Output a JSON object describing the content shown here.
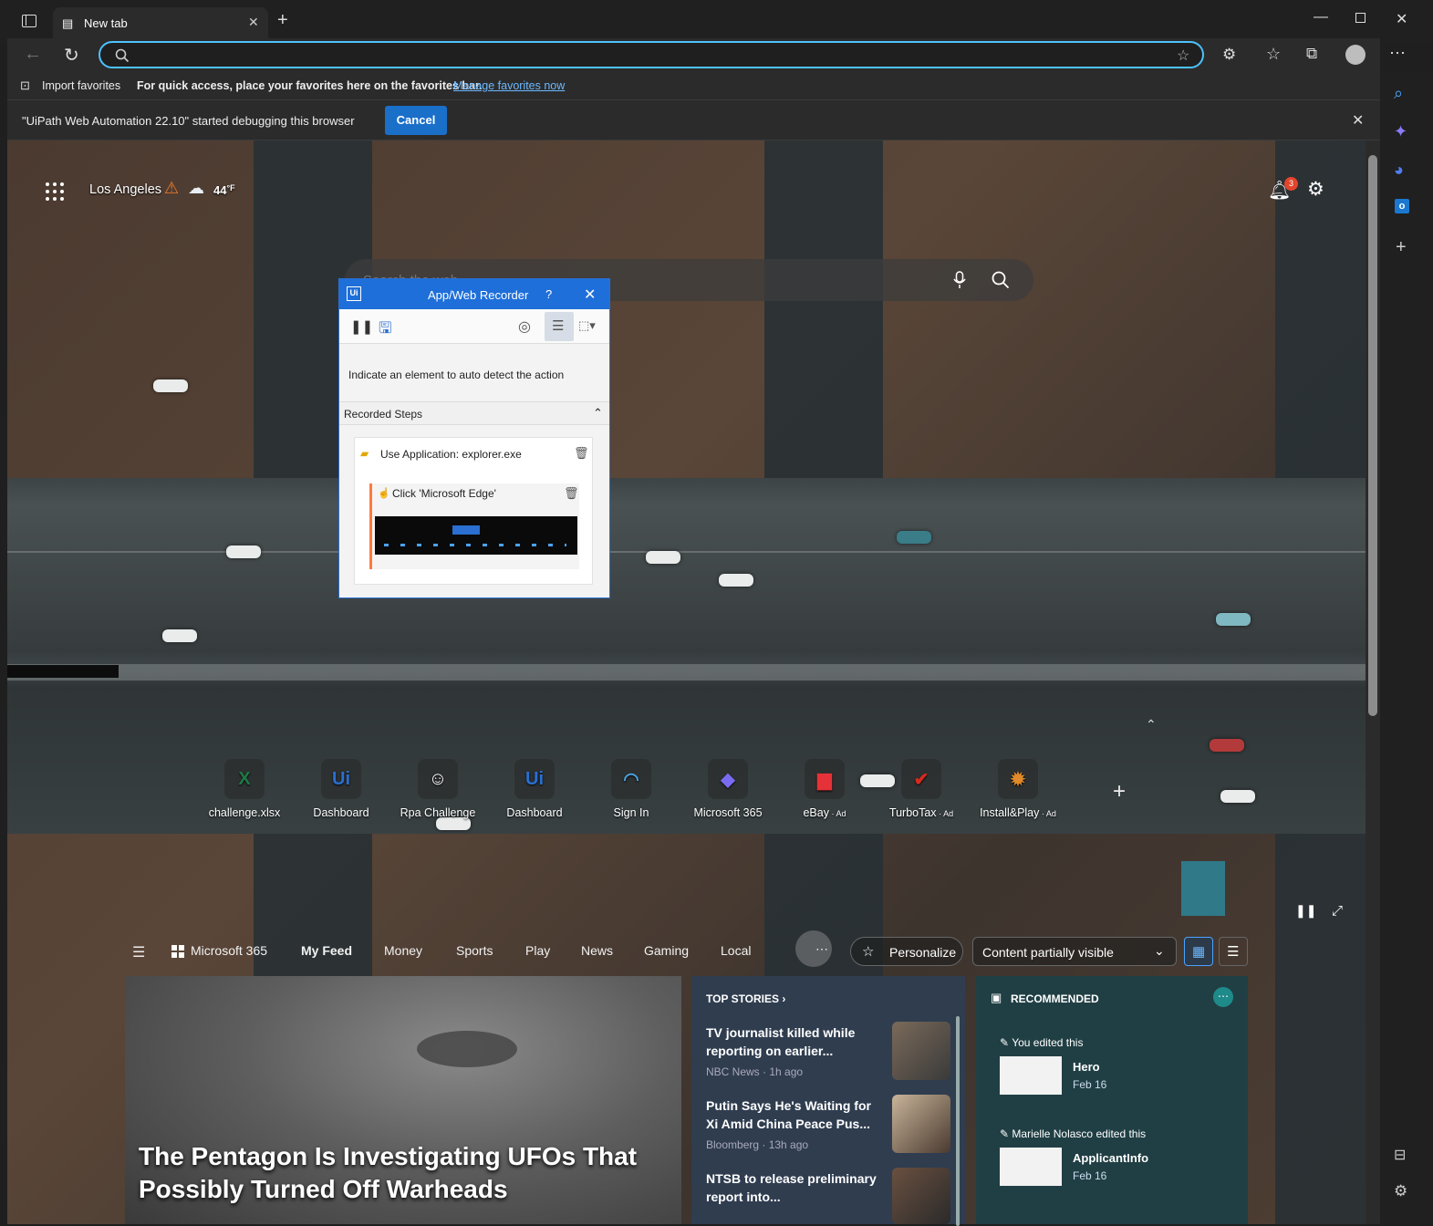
{
  "browser": {
    "tab_title": "New tab",
    "address_value": "",
    "favorites_bar": {
      "import_label": "Import favorites",
      "message": "For quick access, place your favorites here on the favorites bar.",
      "manage_link": "Manage favorites now"
    },
    "infobar": {
      "message": "\"UiPath Web Automation 22.10\" started debugging this browser",
      "cancel_label": "Cancel"
    }
  },
  "newtab": {
    "location": "Los Angeles",
    "temperature": "44",
    "temp_unit": "°F",
    "notification_count": "3",
    "search_placeholder": "Search the web",
    "quick_links": [
      {
        "label": "challenge.xlsx",
        "ad": "",
        "icon": "excel-icon",
        "glyph": "X",
        "color": "#1d7a46"
      },
      {
        "label": "Dashboard",
        "ad": "",
        "icon": "uipath-icon",
        "glyph": "Ui",
        "color": "#2a6fd1"
      },
      {
        "label": "Rpa Challenge",
        "ad": "",
        "icon": "robot-icon",
        "glyph": "☺",
        "color": "#ffffff"
      },
      {
        "label": "Dashboard",
        "ad": "",
        "icon": "uipath-icon",
        "glyph": "Ui",
        "color": "#2a6fd1"
      },
      {
        "label": "Sign In",
        "ad": "",
        "icon": "signin-icon",
        "glyph": "◠",
        "color": "#4aa3df"
      },
      {
        "label": "Microsoft 365",
        "ad": "",
        "icon": "m365-icon",
        "glyph": "◆",
        "color": "#7a6cf0"
      },
      {
        "label": "eBay",
        "ad": "· Ad",
        "icon": "ebay-icon",
        "glyph": "▆",
        "color": "#e53238"
      },
      {
        "label": "TurboTax",
        "ad": "· Ad",
        "icon": "turbotax-icon",
        "glyph": "✔",
        "color": "#d52b1e"
      },
      {
        "label": "Install&Play",
        "ad": "· Ad",
        "icon": "game-icon",
        "glyph": "✹",
        "color": "#e08a2a"
      }
    ],
    "nav": {
      "m365": "Microsoft 365",
      "tabs": [
        "My Feed",
        "Money",
        "Sports",
        "Play",
        "News",
        "Gaming",
        "Local"
      ],
      "personalize": "Personalize",
      "content_visibility": "Content partially visible"
    },
    "hero_title": "The Pentagon Is Investigating UFOs That Possibly Turned Off Warheads",
    "top_stories": {
      "header": "TOP STORIES",
      "items": [
        {
          "title": "TV journalist killed while reporting on earlier...",
          "meta": "NBC News · 1h ago"
        },
        {
          "title": "Putin Says He's Waiting for Xi Amid China Peace Pus...",
          "meta": "Bloomberg · 13h ago"
        },
        {
          "title": "NTSB to release preliminary report into...",
          "meta": ""
        }
      ]
    },
    "recommended": {
      "header": "RECOMMENDED",
      "items": [
        {
          "editor": "You edited this",
          "name": "Hero",
          "date": "Feb 16"
        },
        {
          "editor": "Marielle Nolasco edited this",
          "name": "ApplicantInfo",
          "date": "Feb 16"
        }
      ]
    }
  },
  "recorder": {
    "title": "App/Web Recorder",
    "help": "?",
    "hint": "Indicate an element to auto detect the action",
    "steps_header": "Recorded Steps",
    "step_parent": "Use Application: explorer.exe",
    "step_child": "Click 'Microsoft Edge'"
  }
}
